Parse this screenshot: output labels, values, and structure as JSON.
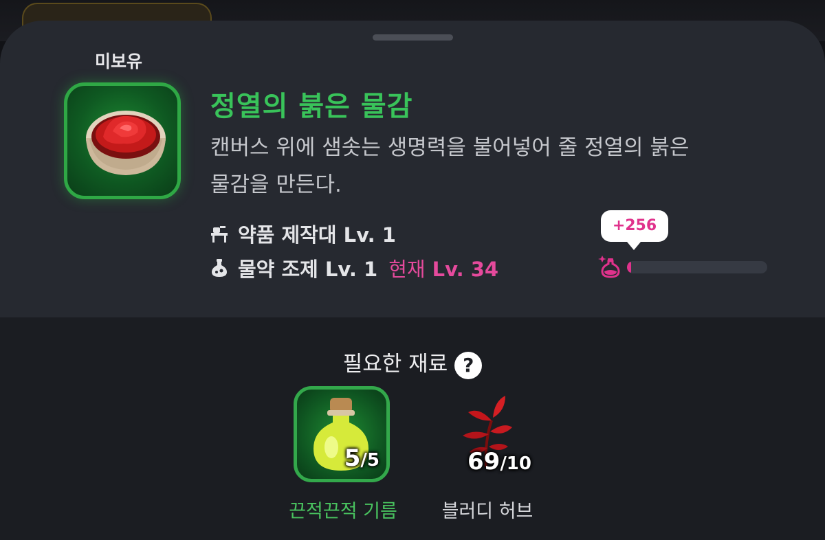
{
  "status": {
    "owned_label": "미보유"
  },
  "item": {
    "icon": "red-paint-bowl-icon",
    "title": "정열의 붉은 물감",
    "description_line1": "캔버스 위에 샘솟는 생명력을 불어넣어 줄 정열의 붉은",
    "description_line2": "물감을 만든다."
  },
  "requirements": {
    "workbench": {
      "icon": "workbench-icon",
      "label": "약품 제작대 Lv. 1"
    },
    "skill": {
      "icon": "potion-flask-icon",
      "label": "물약 조제 Lv. 1",
      "current_prefix": "현재",
      "current_level": "Lv. 34"
    }
  },
  "xp": {
    "gain": "+256",
    "icon": "potion-sparkle-icon",
    "progress": 0.03
  },
  "materials": {
    "title": "필요한 재료",
    "help_icon": "?",
    "items": [
      {
        "name": "끈적끈적 기름",
        "owned": "5",
        "required": "/5",
        "icon": "oil-bottle-icon",
        "sufficient": true
      },
      {
        "name": "블러디 허브",
        "owned": "69",
        "required": "/10",
        "icon": "red-herb-icon",
        "sufficient": false
      }
    ]
  },
  "colors": {
    "accent_green": "#39c35a",
    "accent_pink": "#e0328c",
    "sheet_bg": "#262930",
    "lower_bg": "#1b1d22"
  }
}
